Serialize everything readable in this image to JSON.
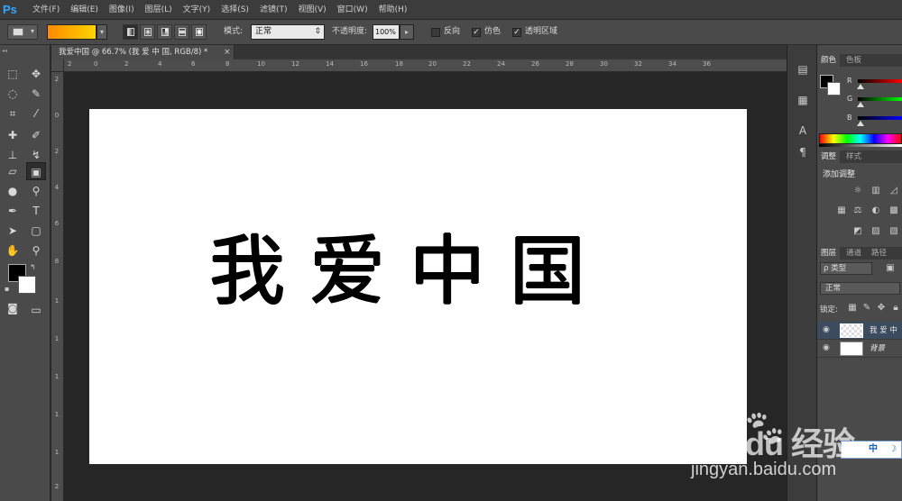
{
  "app": {
    "logo": "Ps",
    "menu": [
      "文件(F)",
      "编辑(E)",
      "图像(I)",
      "图层(L)",
      "文字(Y)",
      "选择(S)",
      "滤镜(T)",
      "视图(V)",
      "窗口(W)",
      "帮助(H)"
    ]
  },
  "options": {
    "mode_label": "模式:",
    "mode_value": "正常",
    "opacity_label": "不透明度:",
    "opacity_value": "100%",
    "reverse_label": "反向",
    "reverse_checked": false,
    "dither_label": "仿色",
    "dither_checked": true,
    "transparency_label": "透明区域",
    "transparency_checked": true,
    "gradient_colors": [
      "#ff8a00",
      "#ffd400"
    ]
  },
  "document": {
    "tab_title": "我爱中国 @ 66.7% (我 爱 中 国, RGB/8) *",
    "close_glyph": "×",
    "canvas_text": "我爱中国",
    "ruler_h": [
      "2",
      "0",
      "2",
      "4",
      "6",
      "8",
      "10",
      "12",
      "14",
      "16",
      "18",
      "20",
      "22",
      "24",
      "26",
      "28",
      "30",
      "32",
      "34",
      "36"
    ],
    "ruler_v": [
      "2",
      "0",
      "2",
      "4",
      "6",
      "8",
      "1",
      "1",
      "1",
      "1",
      "1",
      "2"
    ]
  },
  "panels": {
    "color_tabs": [
      "颜色",
      "色板"
    ],
    "channels": [
      "R",
      "G",
      "B"
    ],
    "adjust_tabs": [
      "调整",
      "样式"
    ],
    "adjust_title": "添加调整",
    "layer_tabs": [
      "图层",
      "通道",
      "路径"
    ],
    "kind_filter": "ρ 类型",
    "blend_mode": "正常",
    "lock_label": "锁定:",
    "layers": [
      {
        "name": "我 爱 中",
        "selected": true
      },
      {
        "name": "背景",
        "selected": false
      }
    ]
  },
  "ime": {
    "lang": "中"
  },
  "watermark": {
    "logo": "Bai du 经验",
    "url": "jingyan.baidu.com"
  }
}
